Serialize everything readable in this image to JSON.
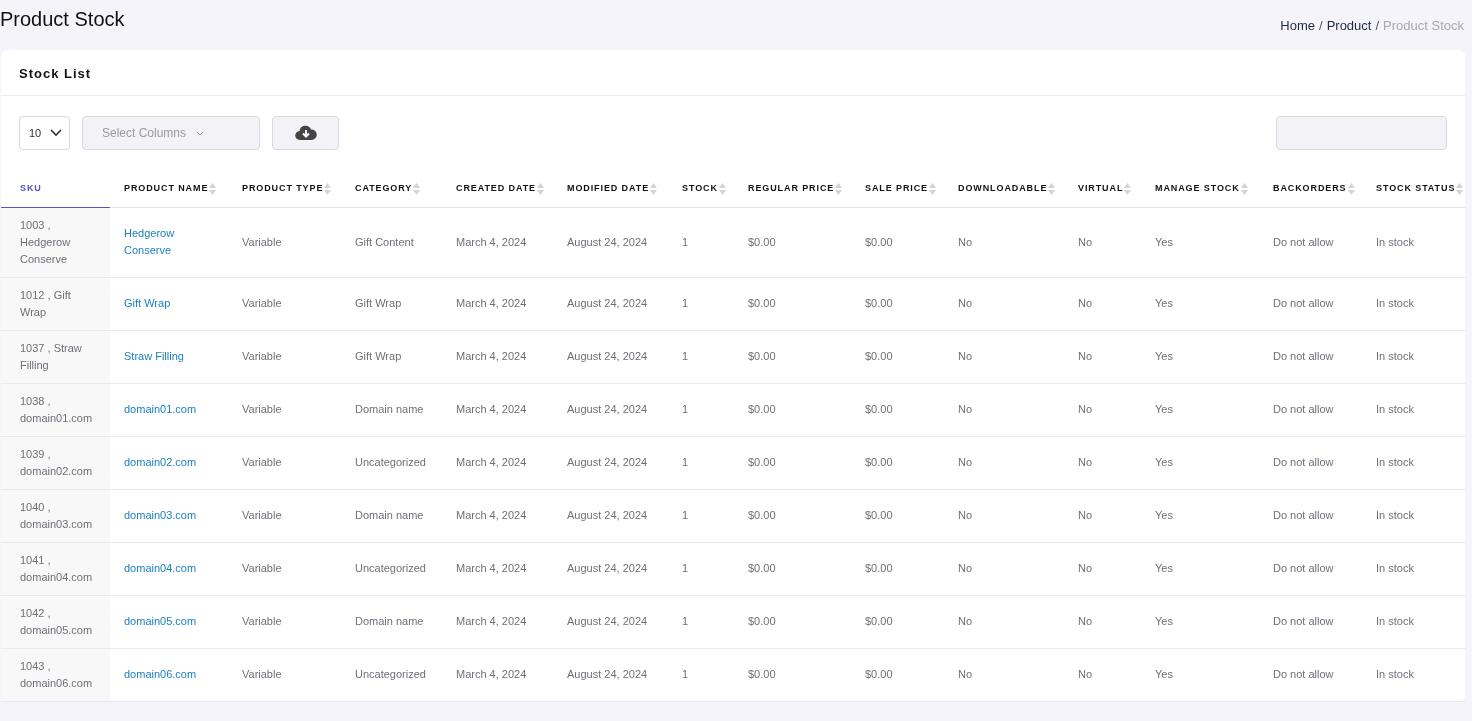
{
  "page_title": "Product Stock",
  "breadcrumb_separator": "/",
  "breadcrumb": [
    {
      "label": "Home",
      "current": false
    },
    {
      "label": "Product",
      "current": false
    },
    {
      "label": "Product Stock",
      "current": true
    }
  ],
  "card_title": "Stock List",
  "page_size": "10",
  "column_picker": {
    "placeholder": "Select Columns"
  },
  "table": {
    "columns": [
      {
        "label": "SKU",
        "sorted": true
      },
      {
        "label": "PRODUCT NAME",
        "sorted": false
      },
      {
        "label": "PRODUCT TYPE",
        "sorted": false
      },
      {
        "label": "CATEGORY",
        "sorted": false
      },
      {
        "label": "CREATED DATE",
        "sorted": false
      },
      {
        "label": "MODIFIED DATE",
        "sorted": false
      },
      {
        "label": "STOCK",
        "sorted": false
      },
      {
        "label": "REGULAR PRICE",
        "sorted": false
      },
      {
        "label": "SALE PRICE",
        "sorted": false
      },
      {
        "label": "DOWNLOADABLE",
        "sorted": false
      },
      {
        "label": "VIRTUAL",
        "sorted": false
      },
      {
        "label": "MANAGE STOCK",
        "sorted": false
      },
      {
        "label": "BACKORDERS",
        "sorted": false
      },
      {
        "label": "STOCK STATUS",
        "sorted": false
      }
    ],
    "rows": [
      [
        "1003 , Hedgerow Conserve",
        "Hedgerow Conserve",
        "Variable",
        "Gift Content",
        "March 4, 2024",
        "August 24, 2024",
        "1",
        "$0.00",
        "$0.00",
        "No",
        "No",
        "Yes",
        "Do not allow",
        "In stock"
      ],
      [
        "1012 , Gift Wrap",
        "Gift Wrap",
        "Variable",
        "Gift Wrap",
        "March 4, 2024",
        "August 24, 2024",
        "1",
        "$0.00",
        "$0.00",
        "No",
        "No",
        "Yes",
        "Do not allow",
        "In stock"
      ],
      [
        "1037 , Straw Filling",
        "Straw Filling",
        "Variable",
        "Gift Wrap",
        "March 4, 2024",
        "August 24, 2024",
        "1",
        "$0.00",
        "$0.00",
        "No",
        "No",
        "Yes",
        "Do not allow",
        "In stock"
      ],
      [
        "1038 , domain01.com",
        "domain01.com",
        "Variable",
        "Domain name",
        "March 4, 2024",
        "August 24, 2024",
        "1",
        "$0.00",
        "$0.00",
        "No",
        "No",
        "Yes",
        "Do not allow",
        "In stock"
      ],
      [
        "1039 , domain02.com",
        "domain02.com",
        "Variable",
        "Uncategorized",
        "March 4, 2024",
        "August 24, 2024",
        "1",
        "$0.00",
        "$0.00",
        "No",
        "No",
        "Yes",
        "Do not allow",
        "In stock"
      ],
      [
        "1040 , domain03.com",
        "domain03.com",
        "Variable",
        "Domain name",
        "March 4, 2024",
        "August 24, 2024",
        "1",
        "$0.00",
        "$0.00",
        "No",
        "No",
        "Yes",
        "Do not allow",
        "In stock"
      ],
      [
        "1041 , domain04.com",
        "domain04.com",
        "Variable",
        "Uncategorized",
        "March 4, 2024",
        "August 24, 2024",
        "1",
        "$0.00",
        "$0.00",
        "No",
        "No",
        "Yes",
        "Do not allow",
        "In stock"
      ],
      [
        "1042 , domain05.com",
        "domain05.com",
        "Variable",
        "Domain name",
        "March 4, 2024",
        "August 24, 2024",
        "1",
        "$0.00",
        "$0.00",
        "No",
        "No",
        "Yes",
        "Do not allow",
        "In stock"
      ],
      [
        "1043 , domain06.com",
        "domain06.com",
        "Variable",
        "Uncategorized",
        "March 4, 2024",
        "August 24, 2024",
        "1",
        "$0.00",
        "$0.00",
        "No",
        "No",
        "Yes",
        "Do not allow",
        "In stock"
      ]
    ]
  }
}
